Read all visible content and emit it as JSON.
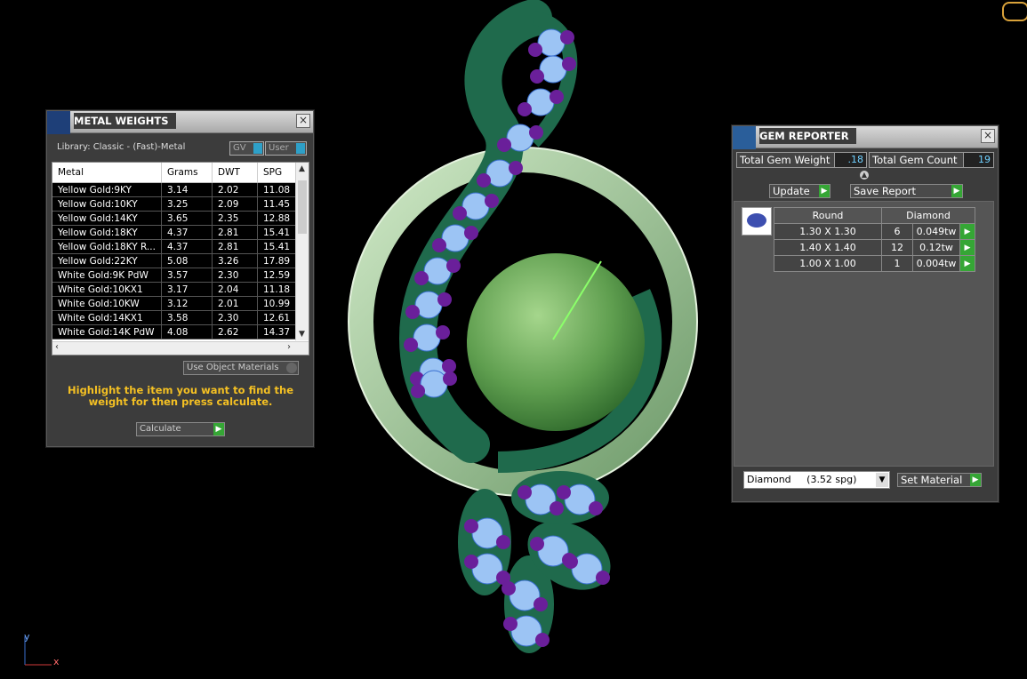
{
  "metal_weights": {
    "title": "METAL WEIGHTS",
    "library": "Library: Classic - (Fast)-Metal",
    "toggles": [
      "GV",
      "User"
    ],
    "columns": [
      "Metal",
      "Grams",
      "DWT",
      "SPG"
    ],
    "rows": [
      [
        "Yellow Gold:9KY",
        "3.14",
        "2.02",
        "11.08"
      ],
      [
        "Yellow Gold:10KY",
        "3.25",
        "2.09",
        "11.45"
      ],
      [
        "Yellow Gold:14KY",
        "3.65",
        "2.35",
        "12.88"
      ],
      [
        "Yellow Gold:18KY",
        "4.37",
        "2.81",
        "15.41"
      ],
      [
        "Yellow Gold:18KY R...",
        "4.37",
        "2.81",
        "15.41"
      ],
      [
        "Yellow Gold:22KY",
        "5.08",
        "3.26",
        "17.89"
      ],
      [
        "White Gold:9K PdW",
        "3.57",
        "2.30",
        "12.59"
      ],
      [
        "White Gold:10KX1",
        "3.17",
        "2.04",
        "11.18"
      ],
      [
        "White Gold:10KW",
        "3.12",
        "2.01",
        "10.99"
      ],
      [
        "White Gold:14KX1",
        "3.58",
        "2.30",
        "12.61"
      ],
      [
        "White Gold:14K PdW",
        "4.08",
        "2.62",
        "14.37"
      ]
    ],
    "use_object_materials": "Use Object Materials",
    "hint": "Highlight the item you want to find the weight for then press calculate.",
    "calculate": "Calculate"
  },
  "gem_reporter": {
    "title": "GEM REPORTER",
    "total_weight_label": "Total Gem Weight",
    "total_weight_value": ".18",
    "total_count_label": "Total Gem Count",
    "total_count_value": "19",
    "update": "Update",
    "save_report": "Save Report",
    "columns": [
      "Round",
      "Diamond"
    ],
    "rows": [
      [
        "1.30 X 1.30",
        "6",
        "0.049tw"
      ],
      [
        "1.40 X 1.40",
        "12",
        "0.12tw"
      ],
      [
        "1.00 X 1.00",
        "1",
        "0.004tw"
      ]
    ],
    "material_select": "Diamond     (3.52 spg)",
    "set_material": "Set Material"
  },
  "axis": {
    "y": "y",
    "x": "x"
  },
  "colors": {
    "accent_green": "#35a635",
    "hint_yellow": "#f4c023",
    "gem_blue": "#9cc4f4",
    "gem_purple": "#6a1f9a"
  }
}
